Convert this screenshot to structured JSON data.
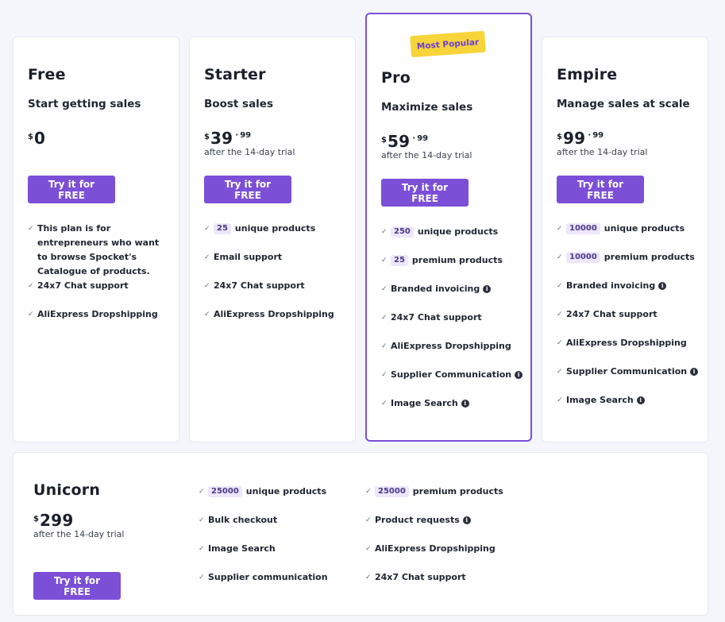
{
  "plans": [
    {
      "name": "Free",
      "subtitle": "Start getting sales",
      "currency": "$",
      "price": "0",
      "cents": "",
      "trial": "",
      "cta": "Try it for FREE",
      "features": [
        {
          "text": "This plan is for entrepreneurs who want to browse Spocket's Catalogue of products."
        },
        {
          "text": "24x7 Chat support"
        },
        {
          "text": "AliExpress Dropshipping"
        }
      ]
    },
    {
      "name": "Starter",
      "subtitle": "Boost sales",
      "currency": "$",
      "price": "39",
      "cents": "99",
      "trial": "after the 14-day trial",
      "cta": "Try it for FREE",
      "features": [
        {
          "badge": "25",
          "text": "unique products"
        },
        {
          "text": "Email support"
        },
        {
          "text": "24x7 Chat support"
        },
        {
          "text": "AliExpress Dropshipping"
        }
      ]
    },
    {
      "name": "Pro",
      "badge": "Most Popular",
      "subtitle": "Maximize sales",
      "currency": "$",
      "price": "59",
      "cents": "99",
      "trial": "after the 14-day trial",
      "cta": "Try it for FREE",
      "features": [
        {
          "badge": "250",
          "text": "unique products"
        },
        {
          "badge": "25",
          "text": "premium products"
        },
        {
          "text": "Branded invoicing",
          "info": true
        },
        {
          "text": "24x7 Chat support"
        },
        {
          "text": "AliExpress Dropshipping"
        },
        {
          "text": "Supplier Communication",
          "info": true
        },
        {
          "text": "Image Search",
          "info": true
        }
      ]
    },
    {
      "name": "Empire",
      "subtitle": "Manage sales at scale",
      "currency": "$",
      "price": "99",
      "cents": "99",
      "trial": "after the 14-day trial",
      "cta": "Try it for FREE",
      "features": [
        {
          "badge": "10000",
          "text": "unique products"
        },
        {
          "badge": "10000",
          "text": "premium products"
        },
        {
          "text": "Branded invoicing",
          "info": true
        },
        {
          "text": "24x7 Chat support"
        },
        {
          "text": "AliExpress Dropshipping"
        },
        {
          "text": "Supplier Communication",
          "info": true
        },
        {
          "text": "Image Search",
          "info": true
        }
      ]
    }
  ],
  "unicorn": {
    "name": "Unicorn",
    "currency": "$",
    "price": "299",
    "trial": "after the 14-day trial",
    "cta": "Try it for FREE",
    "features_col1": [
      {
        "badge": "25000",
        "text": "unique products"
      },
      {
        "text": "Bulk checkout"
      },
      {
        "text": "Image Search"
      },
      {
        "text": "Supplier communication"
      }
    ],
    "features_col2": [
      {
        "badge": "25000",
        "text": "premium products"
      },
      {
        "text": "Product requests",
        "info": true
      },
      {
        "text": "AliExpress Dropshipping"
      },
      {
        "text": "24x7 Chat support"
      }
    ]
  },
  "icons": {
    "check": "✓",
    "info": "i"
  },
  "colors": {
    "accent": "#7b4fd6",
    "popular_badge": "#f7d43a",
    "feature_badge_bg": "#ede6fc"
  }
}
